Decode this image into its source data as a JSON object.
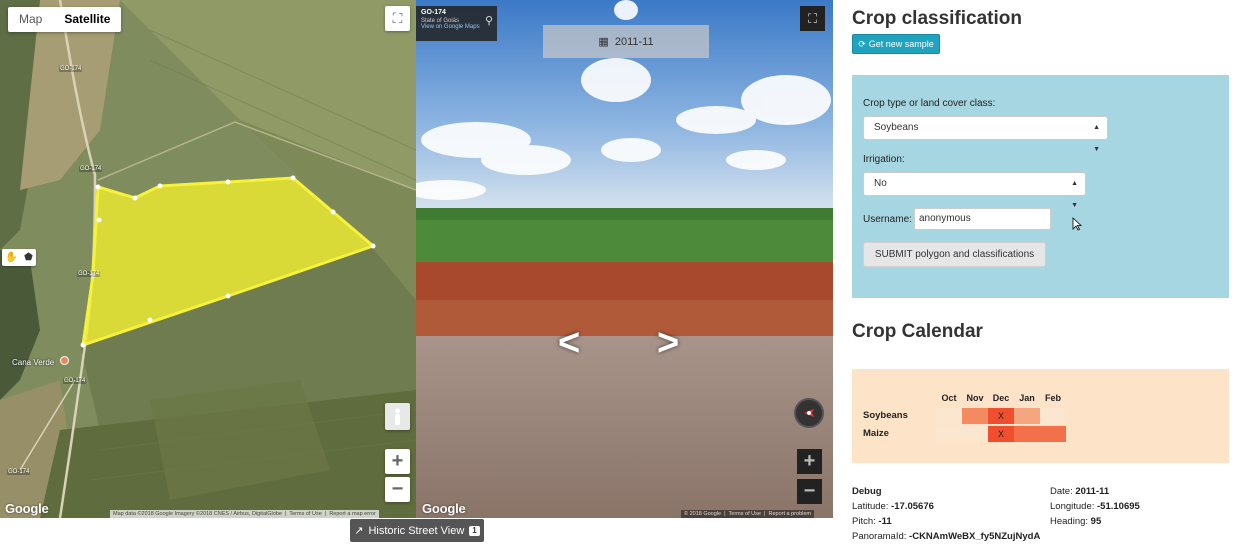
{
  "map": {
    "maptype_options": [
      "Map",
      "Satellite"
    ],
    "maptype_selected": "Satellite",
    "road_labels": [
      "GO-174",
      "GO-174",
      "GO-174",
      "GO-174",
      "GO-174"
    ],
    "town_label": "Cana Verde",
    "google_logo": "Google",
    "attribution": "Map data ©2018 Google Imagery ©2018 CNES / Airbus, DigitalGlobe",
    "terms": "Terms of Use",
    "report": "Report a map error",
    "polygon_color": "#f2ee2e"
  },
  "streetview": {
    "road": "GO-174",
    "state": "State of Goiás",
    "view_link": "View on Google Maps",
    "date": "2011-11",
    "google_logo": "Google",
    "attribution": "© 2018 Google",
    "terms": "Terms of Use",
    "report": "Report a problem",
    "historic_label": "Historic Street View",
    "historic_badge": "1"
  },
  "classification": {
    "title": "Crop classification",
    "sample_button": "Get new sample",
    "crop_label": "Crop type or land cover class:",
    "crop_value": "Soybeans",
    "irrigation_label": "Irrigation:",
    "irrigation_value": "No",
    "username_label": "Username:",
    "username_value": "anonymous",
    "submit_label": "SUBMIT polygon and classifications",
    "accent_color": "#1fa3bf",
    "box_color": "#a6d6e2"
  },
  "calendar": {
    "title": "Crop Calendar",
    "months": [
      "Oct",
      "Nov",
      "Dec",
      "Jan",
      "Feb"
    ],
    "rows": [
      {
        "crop": "Soybeans",
        "cells": [
          "",
          "",
          "X",
          "",
          ""
        ]
      },
      {
        "crop": "Maize",
        "cells": [
          "",
          "",
          "X",
          "",
          ""
        ]
      }
    ],
    "box_color": "#fde3c8"
  },
  "debug": {
    "title": "Debug",
    "latitude_label": "Latitude:",
    "latitude": "-17.05676",
    "longitude_label": "Longitude:",
    "longitude": "-51.10695",
    "pitch_label": "Pitch:",
    "pitch": "-11",
    "heading_label": "Heading:",
    "heading": "95",
    "date_label": "Date:",
    "date": "2011-11",
    "pano_label": "PanoramaId:",
    "pano": "-CKNAmWeBX_fy5NZujNydA"
  }
}
